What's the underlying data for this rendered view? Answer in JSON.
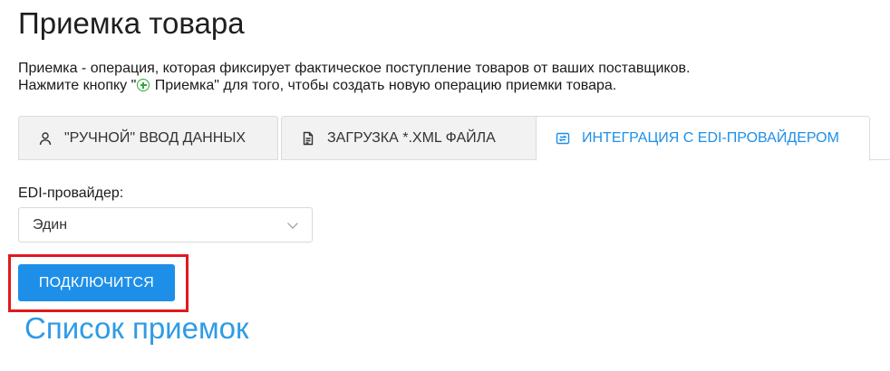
{
  "page": {
    "title": "Приемка товара",
    "intro_line1": "Приемка - операция, которая фиксирует фактическое поступление товаров от ваших поставщиков.",
    "intro_line2_before": "Нажмите кнопку \"",
    "intro_line2_button": " Приемка",
    "intro_line2_after": "\" для того, чтобы создать новую операцию приемки товара.",
    "intro_icon": "plus-circle-icon"
  },
  "tabs": [
    {
      "label": "\"РУЧНОЙ\" ВВОД ДАННЫХ",
      "icon": "user-icon",
      "active": false
    },
    {
      "label": "ЗАГРУЗКА *.XML ФАЙЛА",
      "icon": "file-icon",
      "active": false
    },
    {
      "label": "ИНТЕГРАЦИЯ С EDI-ПРОВАЙДЕРОМ",
      "icon": "sync-icon",
      "active": true
    }
  ],
  "form": {
    "provider_label": "EDI-провайдер:",
    "provider_value": "Эдин",
    "connect_label": "ПОДКЛЮЧИТСЯ"
  },
  "list": {
    "title": "Список приемок"
  },
  "colors": {
    "accent": "#1e8fe8",
    "highlight": "#e0191e",
    "plus_icon": "#2eaa3a"
  }
}
